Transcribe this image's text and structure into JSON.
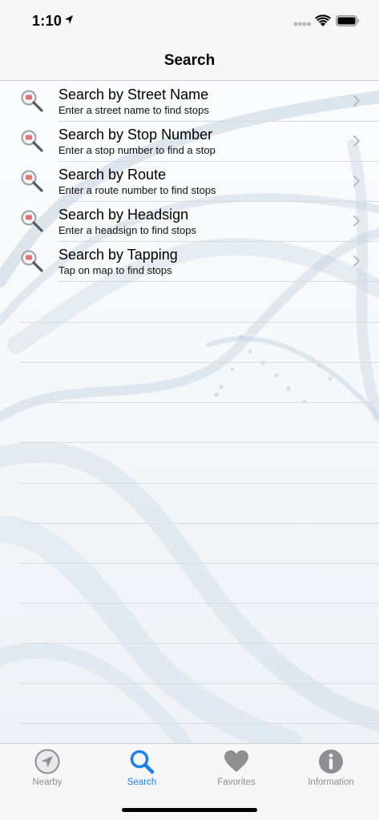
{
  "status_bar": {
    "time": "1:10",
    "location_icon": "location-arrow-icon",
    "signal_icon": "cellular-signal-icon",
    "wifi_icon": "wifi-icon",
    "battery_icon": "battery-icon"
  },
  "nav": {
    "title": "Search"
  },
  "search_options": [
    {
      "title": "Search by Street Name",
      "subtitle": "Enter a street name to find stops",
      "icon": "magnifier-icon"
    },
    {
      "title": "Search by Stop Number",
      "subtitle": "Enter a stop number to find a stop",
      "icon": "magnifier-icon"
    },
    {
      "title": "Search by Route",
      "subtitle": "Enter a route number to find stops",
      "icon": "magnifier-icon"
    },
    {
      "title": "Search by Headsign",
      "subtitle": "Enter a headsign to find stops",
      "icon": "magnifier-icon"
    },
    {
      "title": "Search by Tapping",
      "subtitle": "Tap on map to find stops",
      "icon": "magnifier-icon"
    }
  ],
  "tab_bar": {
    "tabs": [
      {
        "label": "Nearby",
        "icon": "compass-arrow-icon",
        "active": false
      },
      {
        "label": "Search",
        "icon": "search-icon",
        "active": true
      },
      {
        "label": "Favorites",
        "icon": "heart-icon",
        "active": false
      },
      {
        "label": "Information",
        "icon": "info-icon",
        "active": false
      }
    ]
  },
  "colors": {
    "accent": "#1a82f0",
    "inactive_tab": "#8e8e93",
    "bar_background": "#f7f7f7",
    "wallpaper_swirl": "#c5d3e0"
  }
}
